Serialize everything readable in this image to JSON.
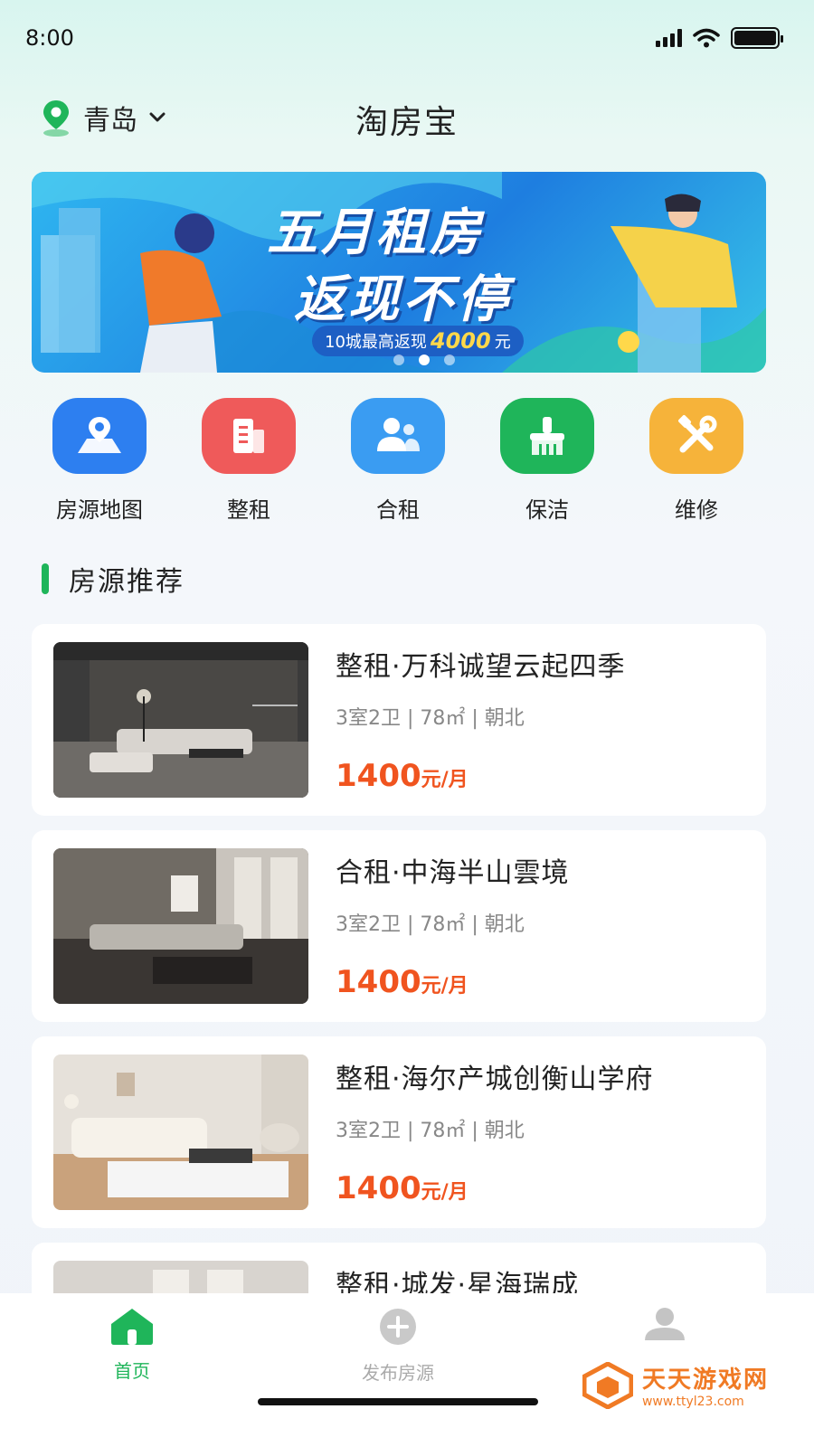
{
  "status": {
    "time": "8:00",
    "battery_level": 1.0
  },
  "nav": {
    "city": "青岛",
    "title": "淘房宝"
  },
  "banner": {
    "line1": "五月租房",
    "line2": "返现不停",
    "sub_prefix": "10城最高返现",
    "sub_amount": "4000",
    "sub_suffix": "元",
    "active_slide": 1,
    "slide_count": 3,
    "colors": {
      "bg": "#2fb6f0",
      "accent": "#ffd84a"
    }
  },
  "categories": [
    {
      "label": "房源地图",
      "icon": "map-pin-icon",
      "color": "#2d7ff0"
    },
    {
      "label": "整租",
      "icon": "building-icon",
      "color": "#ef5a5a"
    },
    {
      "label": "合租",
      "icon": "users-icon",
      "color": "#3a9cf2"
    },
    {
      "label": "保洁",
      "icon": "broom-icon",
      "color": "#1fb55a"
    },
    {
      "label": "维修",
      "icon": "tools-icon",
      "color": "#f6b33a"
    }
  ],
  "section": {
    "title": "房源推荐",
    "accent": "#1fb55a"
  },
  "listings": [
    {
      "title": "整租·万科诚望云起四季",
      "meta": "3室2卫 | 78㎡ | 朝北",
      "price": "1400",
      "unit": "元/月"
    },
    {
      "title": "合租·中海半山雲境",
      "meta": "3室2卫 | 78㎡ | 朝北",
      "price": "1400",
      "unit": "元/月"
    },
    {
      "title": "整租·海尔产城创衡山学府",
      "meta": "3室2卫 | 78㎡ | 朝北",
      "price": "1400",
      "unit": "元/月"
    },
    {
      "title": "整租·城发·星海瑞成"
    }
  ],
  "tabbar": {
    "tabs": [
      {
        "label": "首页",
        "icon": "home-icon",
        "active": true
      },
      {
        "label": "发布房源",
        "icon": "plus-circle-icon",
        "active": false
      },
      {
        "label": "",
        "icon": "user-icon",
        "active": false
      }
    ],
    "active_color": "#1fb55a",
    "inactive_color": "#bbbbbb"
  },
  "watermark": {
    "name": "天天游戏网",
    "url": "www.ttyl23.com"
  }
}
